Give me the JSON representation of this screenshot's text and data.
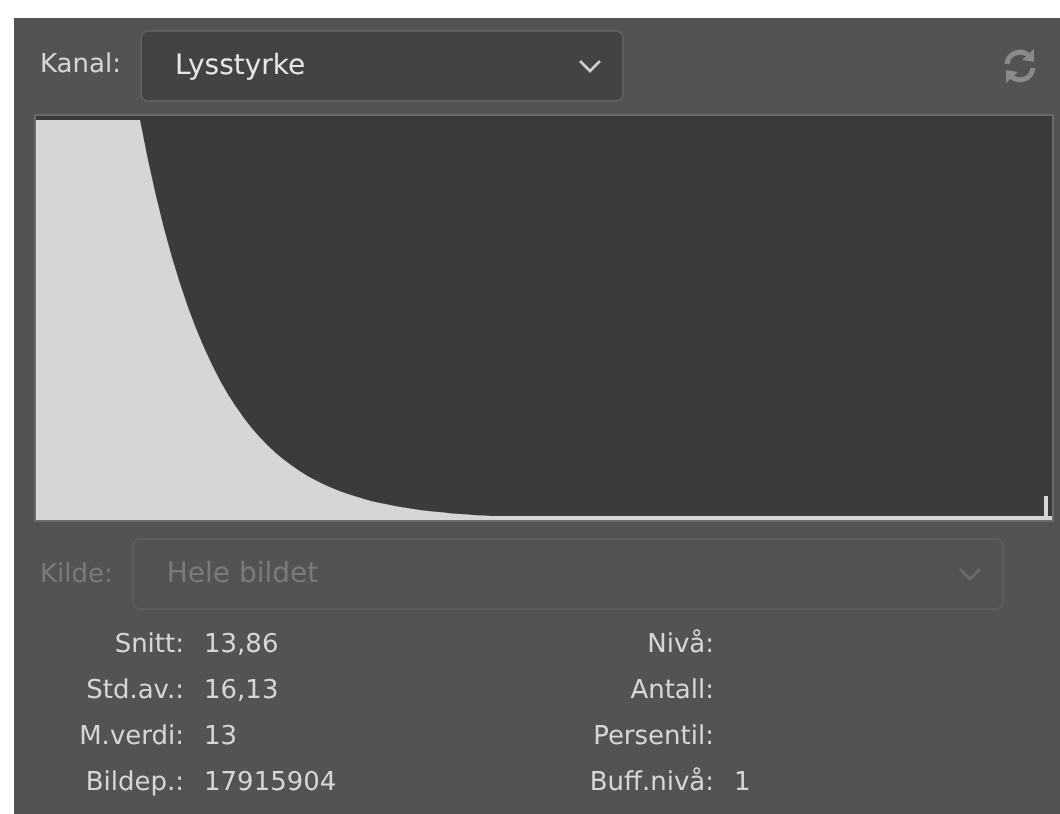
{
  "channel": {
    "label": "Kanal:",
    "value": "Lysstyrke",
    "disabled": false
  },
  "source": {
    "label": "Kilde:",
    "value": "Hele bildet",
    "disabled": true
  },
  "stats_left": [
    {
      "label": "Snitt:",
      "value": "13,86"
    },
    {
      "label": "Std.av.:",
      "value": "16,13"
    },
    {
      "label": "M.verdi:",
      "value": "13"
    },
    {
      "label": "Bildep.:",
      "value": "17915904"
    }
  ],
  "stats_right": [
    {
      "label": "Nivå:"
    },
    {
      "label": "Antall:"
    },
    {
      "label": "Persentil:"
    },
    {
      "label": "Buff.nivå:",
      "value": "1"
    }
  ]
}
